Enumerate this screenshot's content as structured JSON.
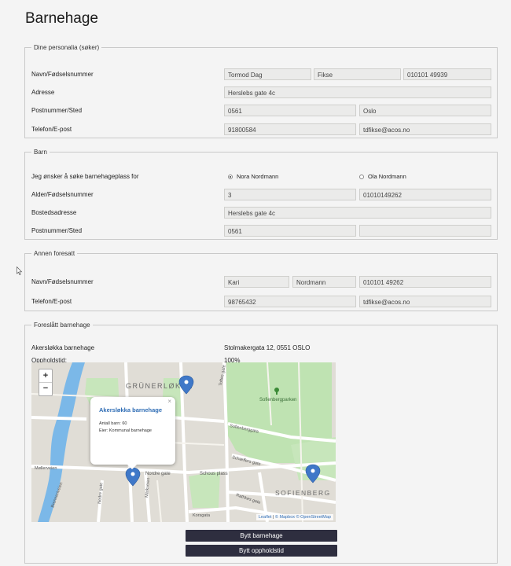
{
  "page_title": "Barnehage",
  "personal": {
    "legend": "Dine personalia (søker)",
    "labels": [
      "Navn/Fødselsnummer",
      "Adresse",
      "Postnummer/Sted",
      "Telefon/E-post"
    ],
    "first_name": "Tormod Dag",
    "last_name": "Fikse",
    "ssn": "010101 49939",
    "address": "Herslebs gate 4c",
    "postal_code": "0561",
    "city": "Oslo",
    "phone": "91800584",
    "email": "tdfikse@acos.no"
  },
  "child": {
    "legend": "Barn",
    "apply_label": "Jeg ønsker å søke barnehageplass for",
    "options": [
      {
        "label": "Nora Nordmann",
        "selected": true
      },
      {
        "label": "Ola Nordmann",
        "selected": false
      }
    ],
    "labels": [
      "Alder/Fødselsnummer",
      "Bostedsadresse",
      "Postnummer/Sted"
    ],
    "age": "3",
    "ssn": "01010149262",
    "address": "Herslebs gate 4c",
    "postal_code": "0561",
    "city": ""
  },
  "other_guardian": {
    "legend": "Annen foresatt",
    "labels": [
      "Navn/Fødselsnummer",
      "Telefon/E-post"
    ],
    "first_name": "Kari",
    "last_name": "Nordmann",
    "ssn": "010101 49262",
    "phone": "98765432",
    "email": "tdfikse@acos.no"
  },
  "suggested": {
    "legend": "Foreslått barnehage",
    "name": "Akersløkka barnehage",
    "address": "Stolmakergata 12, 0551 OSLO",
    "hours_label": "Oppholdstid:",
    "hours": "100%"
  },
  "map": {
    "zoom_in": "+",
    "zoom_out": "−",
    "labels": {
      "grunerlokka": "GRÜNERLØKKA",
      "sofienbergparken": "Sofienbergparken",
      "sofienberg": "SOFIENBERG",
      "nordre_gate": "Nordre gate",
      "schous_plass": "Schous plass",
      "mollerveien": "Møllerveien",
      "sofienberggata": "Sofienberggata",
      "schaeffers": "Schæffers gate",
      "toftes": "Toftes gate",
      "rathkes": "Rathkes gate",
      "korsgata": "Korsgata",
      "markveien": "Markveien",
      "nedre_gate": "Nedre gate",
      "akerselva": "Brenneriveien"
    },
    "popup": {
      "title": "Akersløkka barnehage",
      "line1": "Antall barn: 60",
      "line2": "Eier: Kommunal barnehage",
      "close": "×"
    },
    "attribution": {
      "leaflet": "Leaflet",
      "mapbox": "© Mapbox",
      "osm": "© OpenStreetMap",
      "sep": " | "
    },
    "colors": {
      "park": "#bfe3b2",
      "water": "#7bb8e8",
      "road": "#ffffff",
      "marker": "#3f78c8"
    }
  },
  "buttons": {
    "change_kindergarten": "Bytt barnehage",
    "change_hours": "Bytt oppholdstid"
  }
}
